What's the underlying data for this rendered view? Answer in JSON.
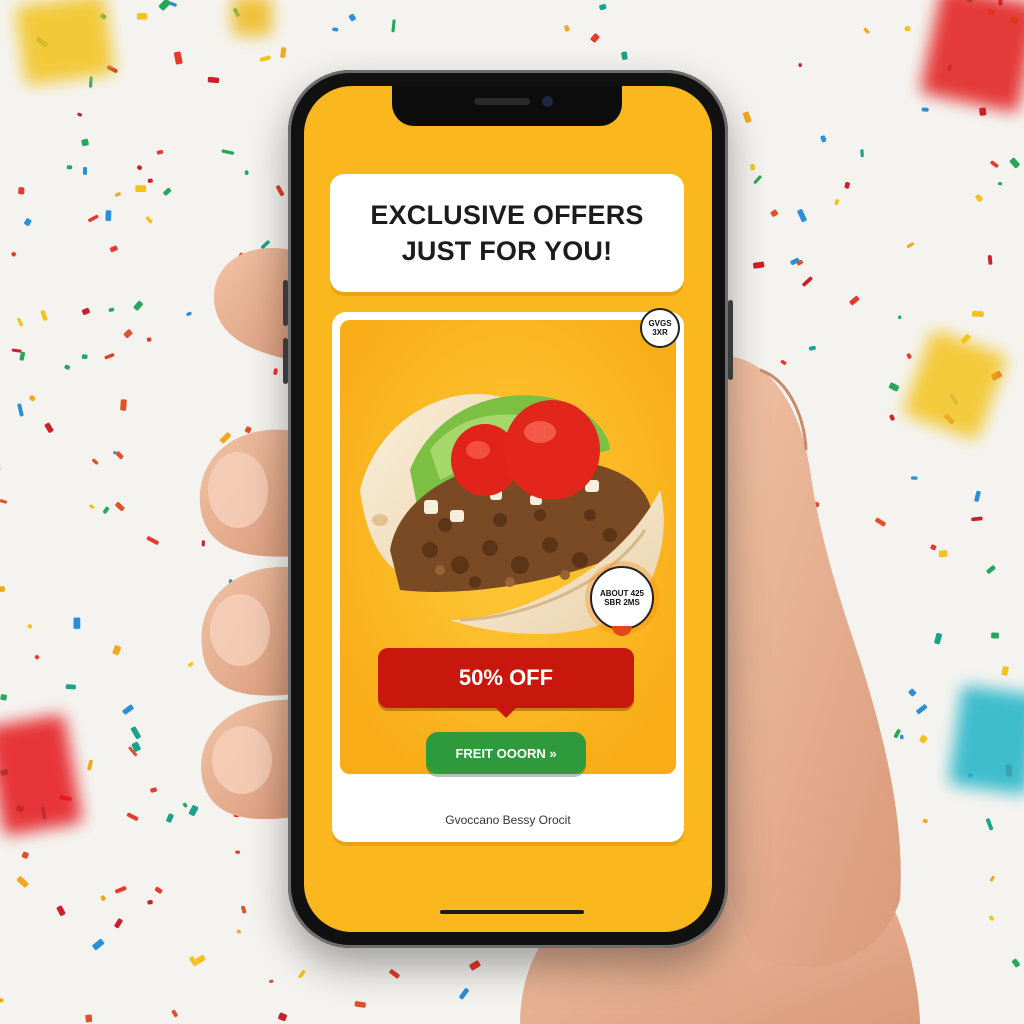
{
  "headline": {
    "line1": "EXCLUSIVE OFFERS",
    "line2": "JUST FOR YOU!"
  },
  "offer": {
    "badge_top": "GVGS 3XR",
    "badge_side": "ABOUT 425 SBR 2MS",
    "discount": "50% OFF",
    "cta": "FREIT OOORN »",
    "footer": "Gvoccano Bessy Orocit"
  },
  "icons": [
    "taco-image",
    "confetti",
    "hand",
    "smartphone"
  ],
  "colors": {
    "screen": "#fbb71e",
    "discount": "#c8180e",
    "cta": "#2e9a3c",
    "card": "#ffffff"
  }
}
